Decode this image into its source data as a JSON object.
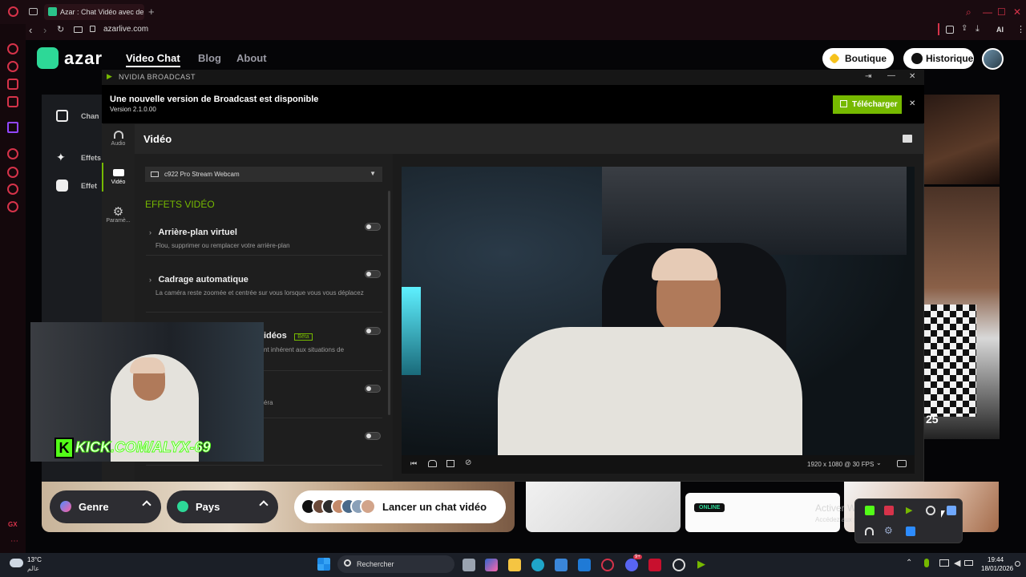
{
  "browser": {
    "tab_title": "Azar : Chat Vidéo avec de",
    "new_tab": "+",
    "url": "azarlive.com",
    "ai_label": "AI"
  },
  "azar": {
    "logo": "azar",
    "nav": {
      "video_chat": "Video Chat",
      "blog": "Blog",
      "about": "About"
    },
    "boutique": "Boutique",
    "historique": "Historique",
    "side_labels": {
      "change": "Chan",
      "effects": "Effets",
      "effects2": "Effet"
    },
    "counter": "25",
    "genre": "Genre",
    "pays": "Pays",
    "launch": "Lancer un chat vidéo",
    "online_badge": "ONLINE",
    "activate_title": "Activer Windows",
    "activate_sub": "Accédez aux paramètres pour activer Windows."
  },
  "nvidia": {
    "window_title": "NVIDIA BROADCAST",
    "update_title": "Une nouvelle version de Broadcast est disponible",
    "update_version": "Version 2.1.0.00",
    "download": "Télécharger",
    "rail": {
      "audio": "Audio",
      "video": "Vidéo",
      "settings": "Paramè..."
    },
    "section_title": "Vidéo",
    "device": "c922 Pro Stream Webcam",
    "effects_header": "EFFETS VIDÉO",
    "effects": [
      {
        "title": "Arrière-plan virtuel",
        "desc": "Flou, supprimer ou remplacer votre arrière-plan"
      },
      {
        "title": "Cadrage automatique",
        "desc": "La caméra reste zoomée et centrée sur vous lorsque vous vous déplacez"
      },
      {
        "title": "idéos",
        "badge": "Bêta",
        "desc": "nt inhérent aux situations de"
      },
      {
        "title": "",
        "desc": "éra"
      }
    ],
    "resolution": "1920 x 1080 @ 30 FPS"
  },
  "kick_overlay": "KICK.COM/ALYX-69",
  "taskbar": {
    "weather_temp": "13°C",
    "weather_city": "عالم",
    "search": "Rechercher",
    "time": "19:44",
    "date": "18/01/2026",
    "badge_count": "9+"
  },
  "colors": {
    "azar_green": "#2dd897",
    "nvidia_green": "#76b900",
    "opera_red": "#d6334a"
  }
}
